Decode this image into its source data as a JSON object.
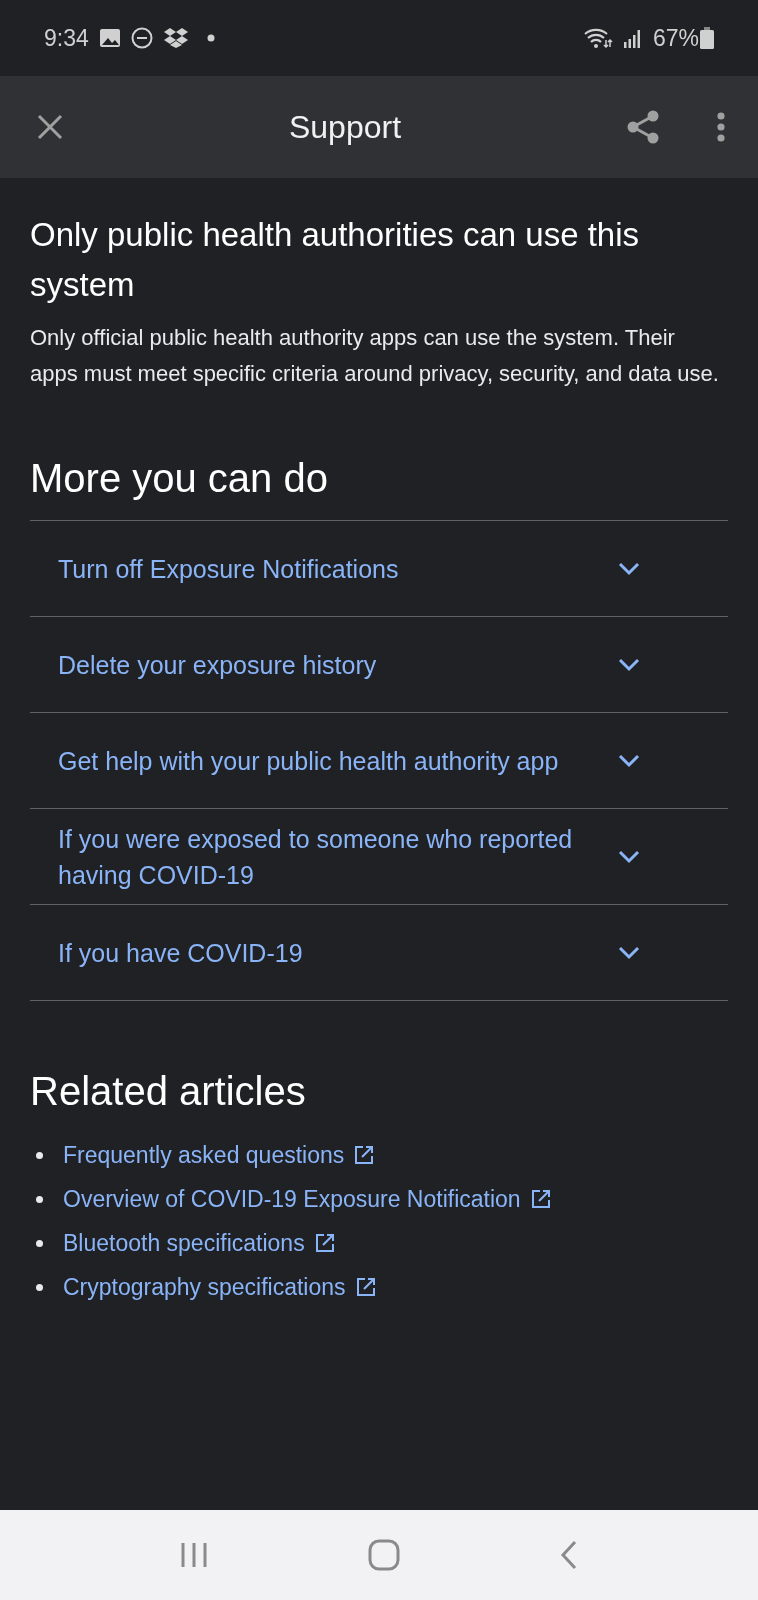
{
  "status_bar": {
    "time": "9:34",
    "battery": "67%"
  },
  "app_bar": {
    "title": "Support"
  },
  "intro": {
    "title": "Only public health authorities can use this system",
    "body": "Only official public health authority apps can use the system. Their apps must meet specific criteria around privacy, security, and data use."
  },
  "more": {
    "heading": "More you can do",
    "items": [
      {
        "label": "Turn off Exposure Notifications",
        "expanded": false
      },
      {
        "label": "Delete your exposure history",
        "expanded": false
      },
      {
        "label": "Get help with your public health authority app",
        "expanded": false
      },
      {
        "label": "If you were exposed to someone who reported having COVID-19",
        "expanded": false
      },
      {
        "label": "If you have COVID-19",
        "expanded": false
      }
    ]
  },
  "related": {
    "heading": "Related articles",
    "links": [
      "Frequently asked questions",
      "Overview of COVID-19 Exposure Notification",
      "Bluetooth specifications",
      "Cryptography specifications"
    ]
  }
}
